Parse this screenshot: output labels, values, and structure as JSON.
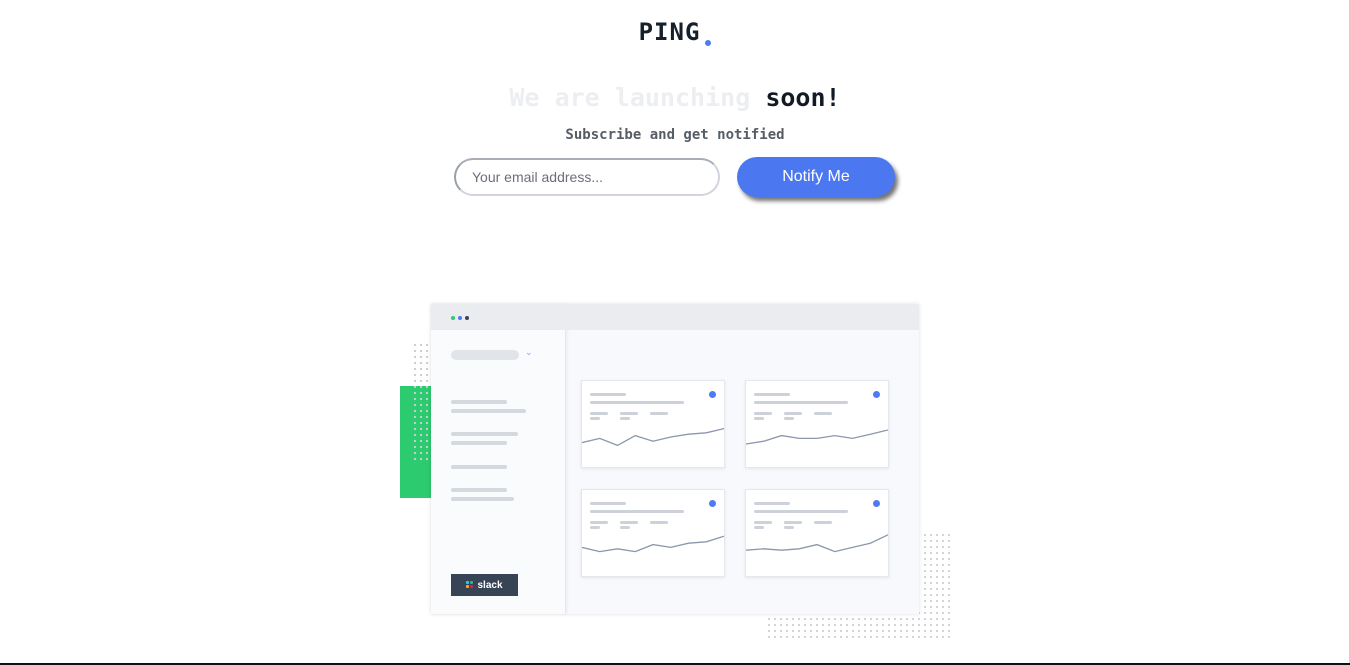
{
  "brand": {
    "name": "PING",
    "accent": "#4d7bf3"
  },
  "headline": {
    "part1": "We are launching",
    "part2": "soon!"
  },
  "subtitle": "Subscribe and get notified",
  "form": {
    "email_placeholder": "Your email address...",
    "email_value": "",
    "submit_label": "Notify Me",
    "button_color": "#4b77f0"
  },
  "illustration": {
    "integration_badge": "slack",
    "accent_green": "#2dcb70",
    "cards": [
      {
        "trend": [
          0.3,
          0.45,
          0.2,
          0.55,
          0.35,
          0.5,
          0.6,
          0.65,
          0.8
        ]
      },
      {
        "trend": [
          0.25,
          0.35,
          0.55,
          0.45,
          0.45,
          0.55,
          0.45,
          0.6,
          0.75
        ]
      },
      {
        "trend": [
          0.45,
          0.3,
          0.4,
          0.3,
          0.55,
          0.45,
          0.6,
          0.65,
          0.85
        ]
      },
      {
        "trend": [
          0.35,
          0.4,
          0.35,
          0.4,
          0.55,
          0.3,
          0.45,
          0.6,
          0.9
        ]
      }
    ]
  }
}
